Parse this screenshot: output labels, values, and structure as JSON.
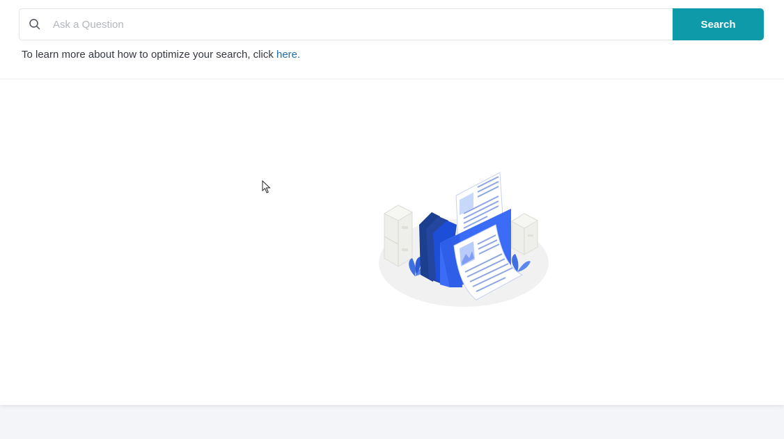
{
  "search": {
    "placeholder": "Ask a Question",
    "value": "",
    "button_label": "Search"
  },
  "help": {
    "prefix": "To learn more about how to optimize your search, click ",
    "link_label": "here."
  },
  "empty_state": {
    "illustration_icon": "documents-folder-illustration"
  },
  "colors": {
    "accent": "#0f9aaa",
    "link": "#1f6fa3",
    "page_background": "#f4f5f9"
  }
}
